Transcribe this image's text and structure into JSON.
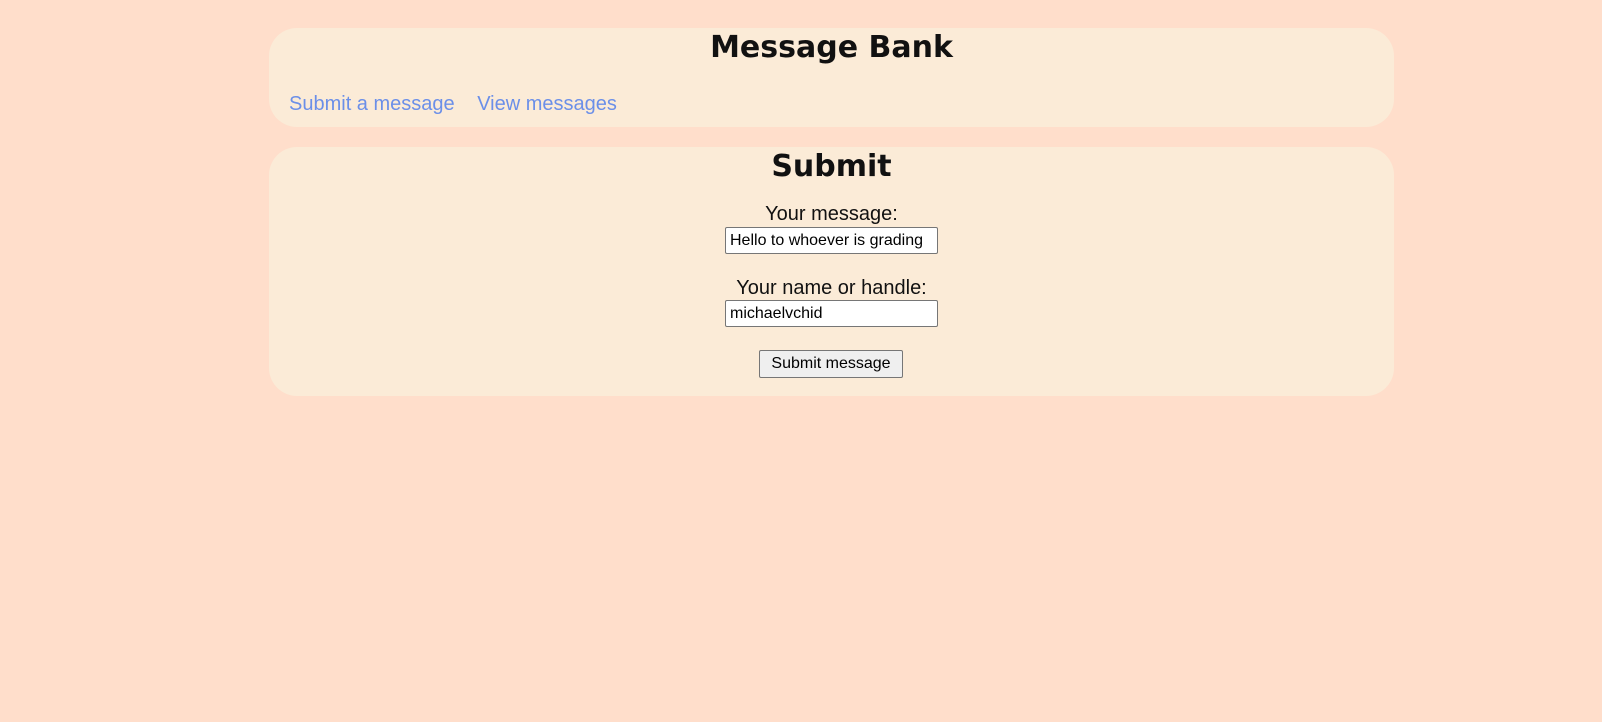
{
  "header": {
    "title": "Message Bank",
    "nav": {
      "submit_link": "Submit a message",
      "view_link": "View messages"
    }
  },
  "form": {
    "title": "Submit",
    "message_label": "Your message:",
    "message_value": "Hello to whoever is grading",
    "name_label": "Your name or handle:",
    "name_value": "michaelvchid",
    "submit_label": "Submit message"
  },
  "colors": {
    "background": "#ffdecb",
    "panel": "#fbebd7",
    "link": "#6b8fe8"
  }
}
